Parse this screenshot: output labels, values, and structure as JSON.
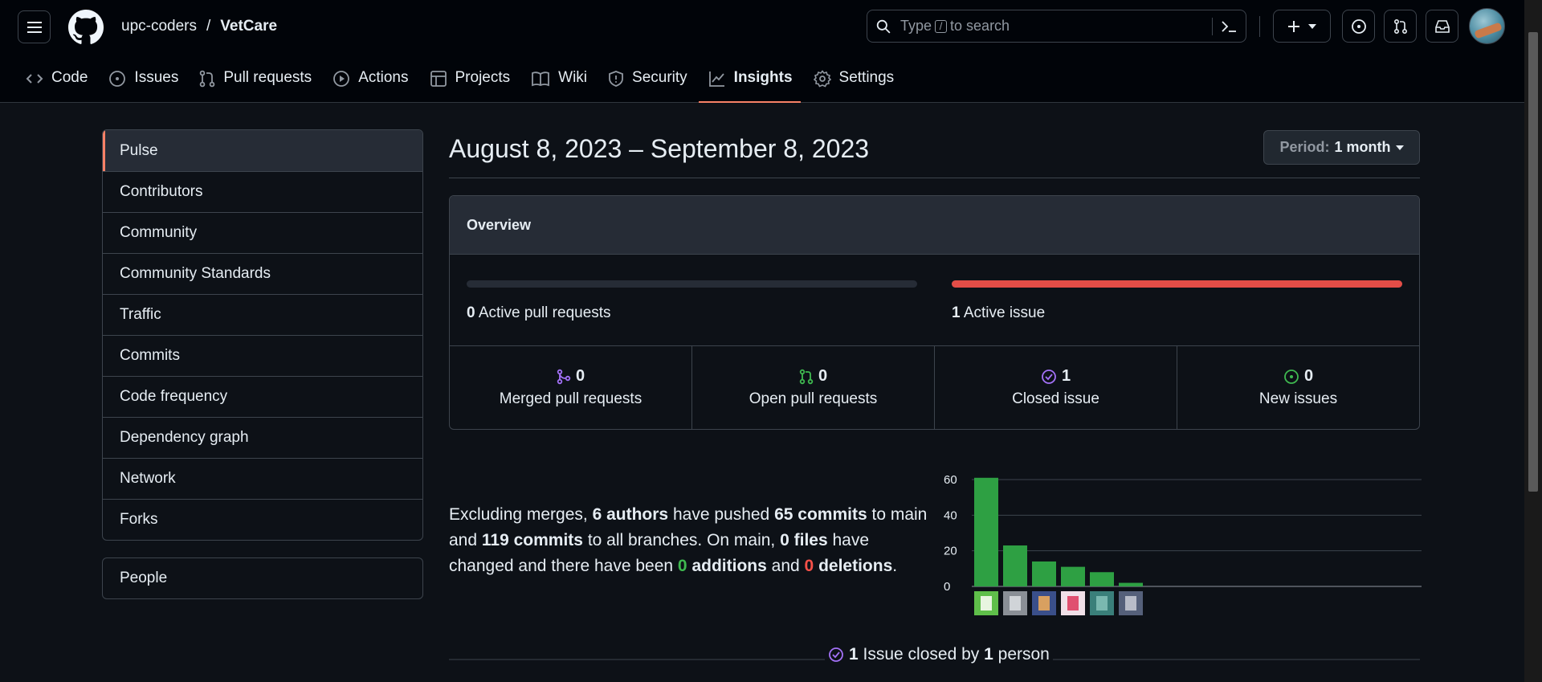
{
  "header": {
    "owner": "upc-coders",
    "separator": "/",
    "repo": "VetCare",
    "search": {
      "prefix": "Type",
      "key": "/",
      "suffix": "to search"
    }
  },
  "tabs": [
    {
      "label": "Code",
      "icon": "code-icon"
    },
    {
      "label": "Issues",
      "icon": "issue-icon"
    },
    {
      "label": "Pull requests",
      "icon": "pull-request-icon"
    },
    {
      "label": "Actions",
      "icon": "play-icon"
    },
    {
      "label": "Projects",
      "icon": "table-icon"
    },
    {
      "label": "Wiki",
      "icon": "book-icon"
    },
    {
      "label": "Security",
      "icon": "shield-icon"
    },
    {
      "label": "Insights",
      "icon": "graph-icon",
      "active": true
    },
    {
      "label": "Settings",
      "icon": "gear-icon"
    }
  ],
  "sidebar": {
    "items": [
      {
        "label": "Pulse",
        "active": true
      },
      {
        "label": "Contributors"
      },
      {
        "label": "Community"
      },
      {
        "label": "Community Standards"
      },
      {
        "label": "Traffic"
      },
      {
        "label": "Commits"
      },
      {
        "label": "Code frequency"
      },
      {
        "label": "Dependency graph"
      },
      {
        "label": "Network"
      },
      {
        "label": "Forks"
      }
    ],
    "secondary": [
      {
        "label": "People"
      }
    ]
  },
  "pulse": {
    "date_range": "August 8, 2023 – September 8, 2023",
    "period_label": "Period:",
    "period_value": "1 month",
    "overview_title": "Overview",
    "active_prs_count": "0",
    "active_prs_label": "Active pull requests",
    "active_issues_count": "1",
    "active_issues_label": "Active issue",
    "active_prs_fraction": 0,
    "active_issues_fraction": 1,
    "stats": [
      {
        "count": "0",
        "label": "Merged pull requests",
        "icon": "merged-icon",
        "color": "#a371f7"
      },
      {
        "count": "0",
        "label": "Open pull requests",
        "icon": "pull-request-icon",
        "color": "#3fb950"
      },
      {
        "count": "1",
        "label": "Closed issue",
        "icon": "issue-closed-icon",
        "color": "#a371f7"
      },
      {
        "count": "0",
        "label": "New issues",
        "icon": "issue-open-icon",
        "color": "#3fb950"
      }
    ],
    "summary": {
      "t1": "Excluding merges,",
      "authors": "6 authors",
      "t2": "have pushed",
      "commits_main": "65 commits",
      "t3": "to main and",
      "commits_all": "119 commits",
      "t4": "to all branches. On main,",
      "files": "0 files",
      "t5": "have changed and there have been",
      "additions_num": "0",
      "additions_word": "additions",
      "t6": "and",
      "deletions_num": "0",
      "deletions_word": "deletions",
      "t7": "."
    },
    "closed_summary": {
      "count": "1",
      "mid": "Issue closed by",
      "people": "1",
      "end": "person"
    }
  },
  "colors": {
    "accent_underline": "#f78166",
    "issue_bar": "#f85149",
    "pr_bar_bg": "#262c36",
    "chart_bar": "#2ea043"
  },
  "chart_data": {
    "type": "bar",
    "categories": [
      "author-1",
      "author-2",
      "author-3",
      "author-4",
      "author-5",
      "author-6"
    ],
    "values": [
      61,
      23,
      14,
      11,
      8,
      2
    ],
    "ylim": [
      0,
      60
    ],
    "yticks": [
      "60",
      "40",
      "20",
      "0"
    ],
    "grid": true
  }
}
